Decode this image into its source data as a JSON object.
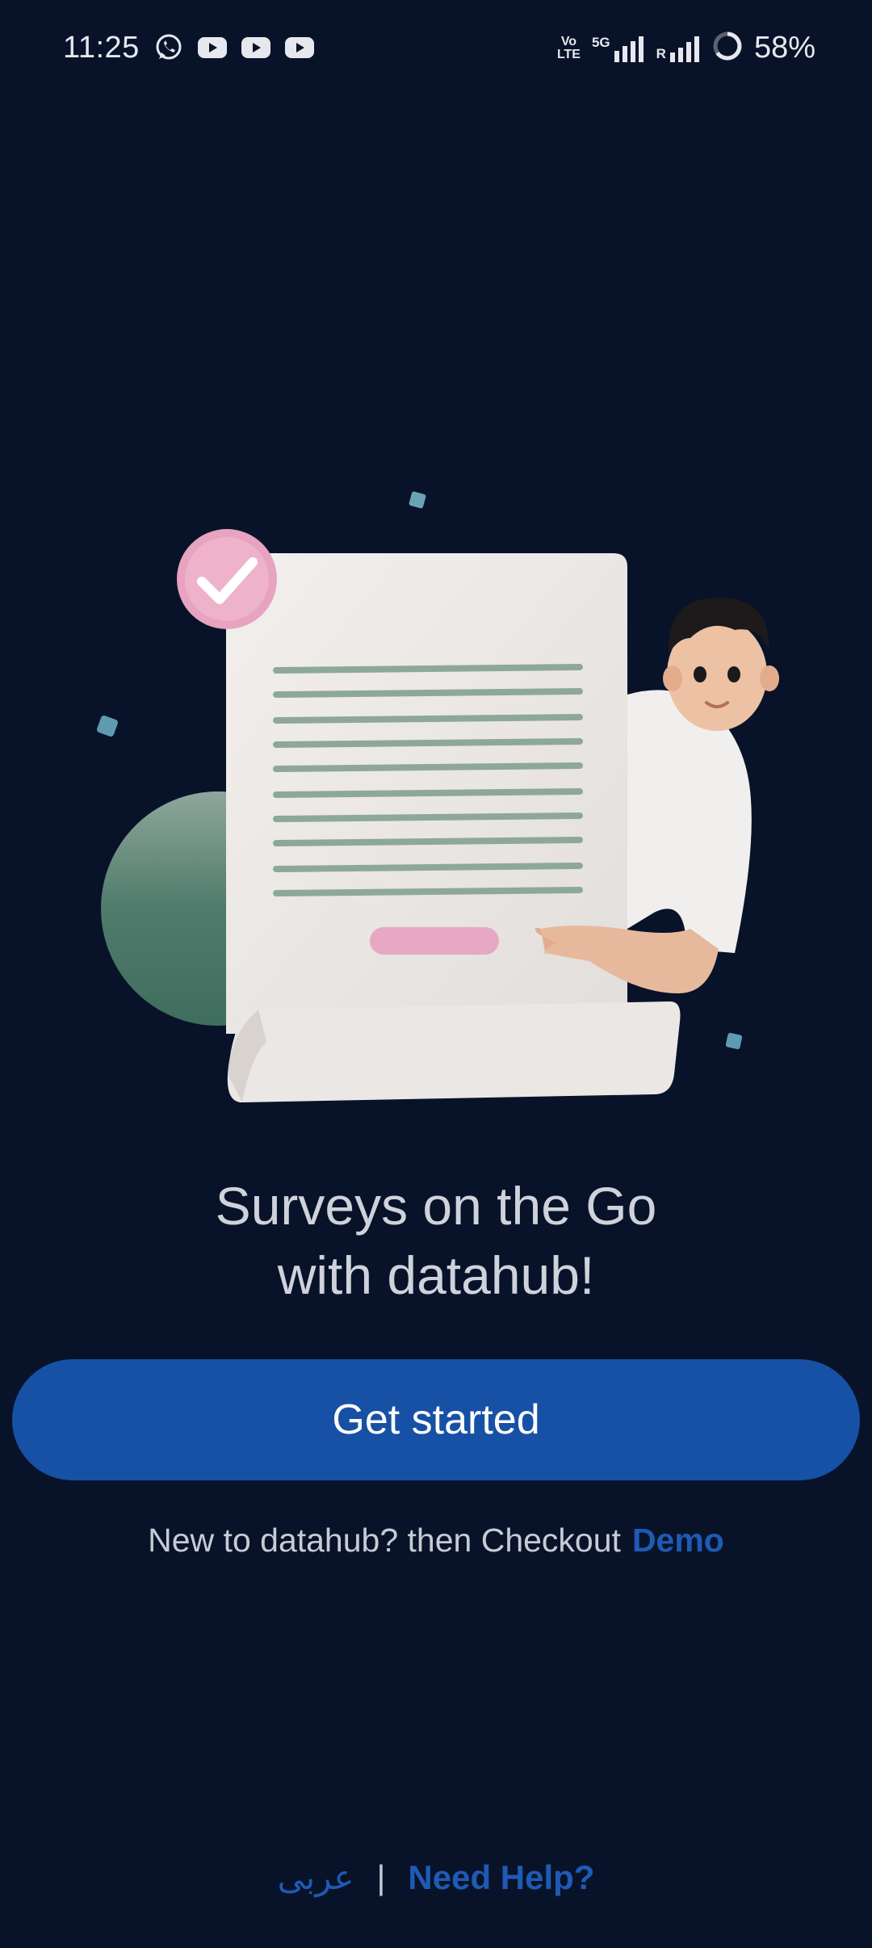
{
  "status_bar": {
    "time": "11:25",
    "left_icons": [
      "whatsapp-icon",
      "youtube-icon",
      "youtube-icon",
      "youtube-icon"
    ],
    "volte_top": "Vo",
    "volte_bottom": "LTE",
    "network": "5G",
    "roaming": "R",
    "battery": "58%"
  },
  "main": {
    "headline_line1": "Surveys on the Go",
    "headline_line2": "with datahub!",
    "cta_label": "Get started",
    "demo_prefix": "New to datahub? then Checkout",
    "demo_link": "Demo"
  },
  "footer": {
    "language_link": "عربى",
    "separator": "|",
    "help_link": "Need Help?"
  },
  "colors": {
    "background": "#08132a",
    "accent": "#1751a6",
    "link": "#1f5ab4"
  }
}
